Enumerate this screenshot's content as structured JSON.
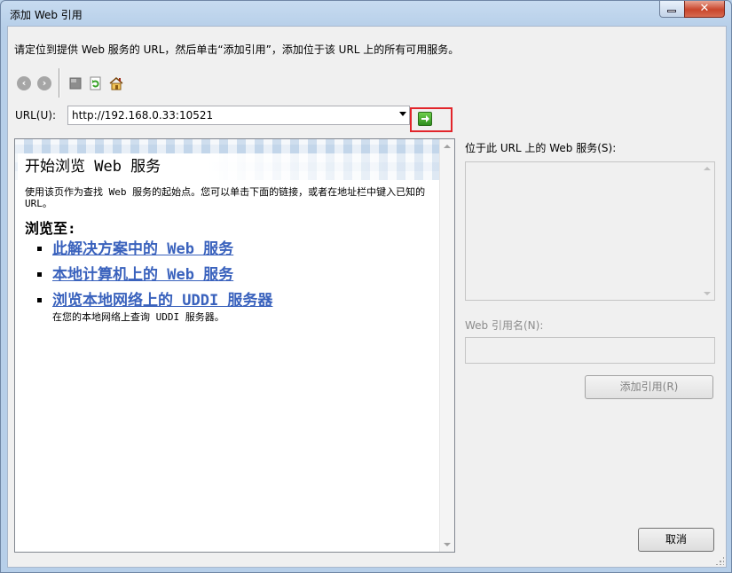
{
  "window": {
    "title": "添加 Web 引用",
    "minimize_label": "",
    "close_label": "✕"
  },
  "instruction": "请定位到提供 Web 服务的 URL，然后单击“添加引用”，添加位于该 URL 上的所有可用服务。",
  "toolbar": {
    "items": [
      "back-icon",
      "forward-icon",
      "stop-icon",
      "refresh-icon",
      "home-icon"
    ]
  },
  "url": {
    "label": "URL(U):",
    "value": "http://192.168.0.33:10521"
  },
  "browser": {
    "banner_title": "开始浏览 Web 服务",
    "intro": "使用该页作为查找 Web 服务的起始点。您可以单击下面的链接，或者在地址栏中键入已知的 URL。",
    "browse_heading": "浏览至:",
    "links": [
      {
        "label": "此解决方案中的 Web 服务"
      },
      {
        "label": "本地计算机上的 Web 服务"
      },
      {
        "label": "浏览本地网络上的 UDDI 服务器"
      }
    ],
    "uddi_description": "在您的本地网络上查询 UDDI 服务器。"
  },
  "services_panel": {
    "label": "位于此 URL 上的 Web 服务(S):",
    "refname_label": "Web 引用名(N):",
    "refname_value": "",
    "add_button": "添加引用(R)"
  },
  "footer": {
    "cancel_button": "取消"
  },
  "colors": {
    "link": "#3a62bd",
    "highlight_border": "#e2252b",
    "disabled_text": "#8c8c8c"
  }
}
